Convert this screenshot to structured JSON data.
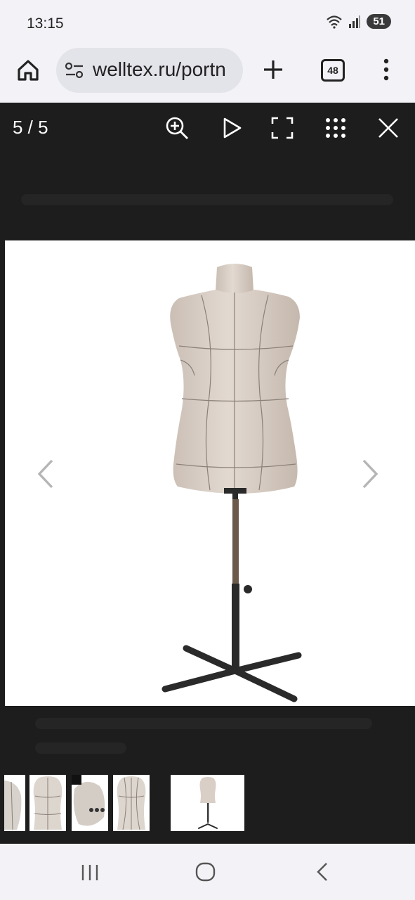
{
  "status_bar": {
    "time": "13:15",
    "battery": "51",
    "icons": [
      "wifi-icon",
      "signal-icon",
      "battery-icon"
    ]
  },
  "browser": {
    "url": "welltex.ru/portn",
    "tab_count": "48",
    "icons": [
      "home-icon",
      "site-settings-icon",
      "plus-icon",
      "tabs-icon",
      "more-icon"
    ]
  },
  "viewer": {
    "counter": "5 / 5",
    "toolbar_icons": [
      "zoom-in-icon",
      "play-icon",
      "fullscreen-icon",
      "grid-icon",
      "close-icon"
    ],
    "nav_icons": [
      "chevron-left-icon",
      "chevron-right-icon"
    ],
    "thumbnail_count": 5,
    "active_thumbnail": 5
  },
  "system_nav": {
    "icons": [
      "recents-icon",
      "home-circle-icon",
      "back-icon"
    ]
  },
  "colors": {
    "viewer_bg": "#1d1d1d",
    "bar_bg": "#f3f3f7",
    "url_bg": "#e3e3ea",
    "mannequin_fabric": "#d9cfc6",
    "stand_metal": "#2a2a2a"
  }
}
